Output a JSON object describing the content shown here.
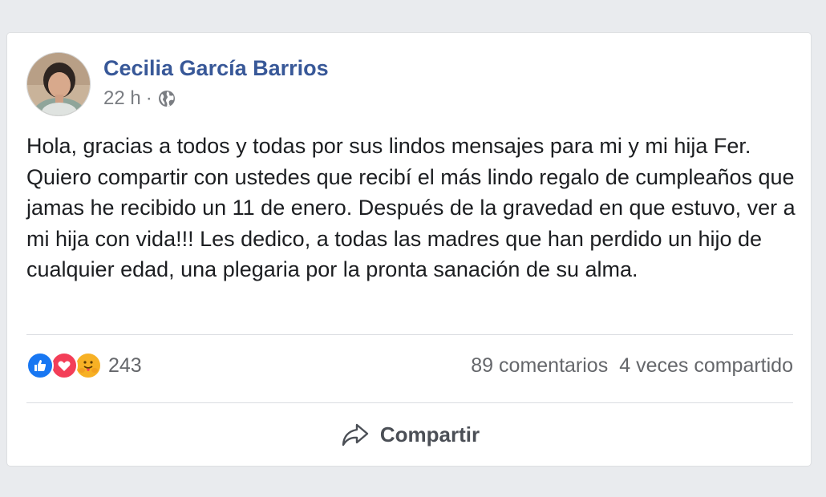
{
  "post": {
    "author": "Cecilia García Barrios",
    "time": "22 h",
    "separator": "·",
    "privacy_icon": "globe-icon",
    "text": "Hola, gracias a todos y todas por sus lindos mensajes para mi y mi hija Fer. Quiero compartir con ustedes que recibí el más lindo regalo de cumpleaños que jamas he recibido un 11 de enero. Después de la gravedad en que estuvo, ver a mi hija con vida!!! Les dedico, a todas las madres que han perdido un hijo de cualquier edad, una plegaria por la pronta sanación de su alma."
  },
  "stats": {
    "reaction_icons": [
      "like-icon",
      "love-icon",
      "care-icon"
    ],
    "reaction_count": "243",
    "comments": "89 comentarios",
    "shares": "4 veces compartido"
  },
  "actions": {
    "share_label": "Compartir",
    "share_icon": "share-arrow-icon"
  },
  "colors": {
    "author": "#385898",
    "like": "#1877f2",
    "love": "#f33e58",
    "care": "#f7b125"
  }
}
